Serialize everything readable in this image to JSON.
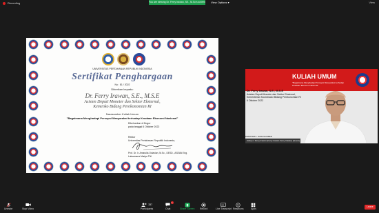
{
  "topbar": {
    "recording": "Recording",
    "ribbon_text": "You are viewing Dr. Ferry Irawan, SE., M.Sc's screen",
    "view_options": "View Options",
    "options_right": "View"
  },
  "certificate": {
    "org": "UNIVERSITAS PERTAHANAN REPUBLIK INDONESIA",
    "title": "Sertifikat Penghargaan",
    "number": "No : 81 / 2022",
    "given_to": "Diberikan kepada:",
    "name": "Dr. Ferry Irawan, S.E., M.S.E",
    "position_line1": "Asisten Deputi Moneter dan Sektor Eksternal,",
    "position_line2": "Kemenko Bidang Perekonomian RI",
    "role": "Narasumber Kuliah Umum",
    "event": "\"Bagaimana Menghadapi Persepsi Masyarakat terhadap Keadaan Ekonomi Nasional\"",
    "place_line1": "Dikeluarkan di Bogor",
    "place_line2": "pada tanggal 6 Oktober 2022",
    "sig_line1": "Rektor",
    "sig_line2": "Universitas Pertahanan Republik Indonesia,",
    "signer_line1": "Prof. Dr. Ir. Amarulla Octavian, M.Sc., DESD., ASEAN Eng.",
    "signer_line2": "Laksamana Madya TNI"
  },
  "video": {
    "banner_title": "KULIAH UMUM",
    "banner_sub1": "\"Bagaimana Menghadapi Persepsi Masyarakat terhadap",
    "banner_sub2": "Keadaan Ekonomi Nasional\"",
    "speaker_name": "Dr. Ferry Irawan, S.E., M.S.E",
    "speaker_title1": "Asisten Deputi Moneter dan Sektor Eksternal,",
    "speaker_title2": "Kementerian Koordinator Bidang Perekonomian RI",
    "date": "6 Oktober 2022",
    "marquee": "PEMATERI • NARASUMBER",
    "name_tag": "Asdep 1 Ferry Irawan (Ferry Irawan Ferry Irawan) (Guest)"
  },
  "toolbar": {
    "unmute": "Unmute",
    "start_video": "Stop Video",
    "participants": "Participants",
    "participants_count": "337",
    "chat": "Chat",
    "chat_count": "1",
    "share_screen": "Share Screen",
    "record": "Record",
    "live_transcript": "Live Transcript",
    "reactions": "Reactions",
    "apps": "Apps",
    "leave": "Leave"
  }
}
